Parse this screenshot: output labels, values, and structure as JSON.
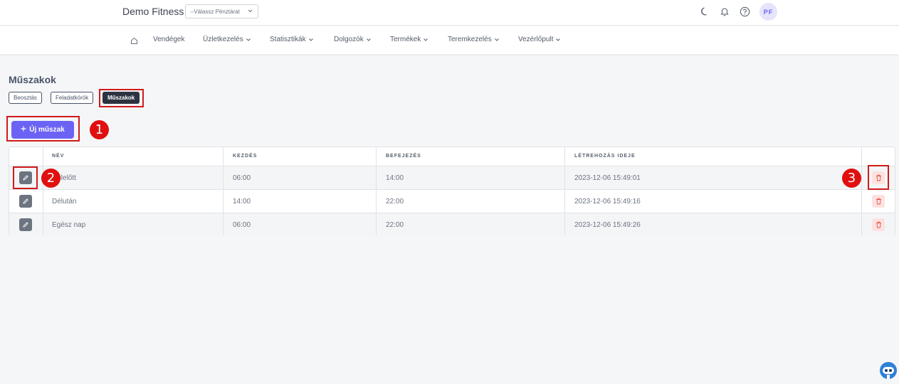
{
  "header": {
    "brand": "Demo Fitness",
    "cashier_select": "--Válassz Pénztárat",
    "avatar": "PF",
    "icons": [
      "moon-icon",
      "bell-icon",
      "help-icon"
    ]
  },
  "nav": {
    "home_icon": "home-icon",
    "items": [
      {
        "label": "Vendégek",
        "dropdown": false
      },
      {
        "label": "Üzletkezelés",
        "dropdown": true
      },
      {
        "label": "Statisztikák",
        "dropdown": true
      },
      {
        "label": "Dolgozók",
        "dropdown": true
      },
      {
        "label": "Termékek",
        "dropdown": true
      },
      {
        "label": "Teremkezelés",
        "dropdown": true
      },
      {
        "label": "Vezérlőpult",
        "dropdown": true
      }
    ]
  },
  "page": {
    "title": "Műszakok",
    "tabs": [
      {
        "label": "Beosztás",
        "active": false
      },
      {
        "label": "Feladatkörök",
        "active": false
      },
      {
        "label": "Műszakok",
        "active": true
      }
    ],
    "new_button": "Új műszak"
  },
  "table": {
    "headers": [
      "NÉV",
      "KEZDÉS",
      "BEFEJEZÉS",
      "LÉTREHOZÁS IDEJE"
    ],
    "rows": [
      {
        "name": "Délelőtt",
        "start": "06:00",
        "end": "14:00",
        "created": "2023-12-06 15:49:01"
      },
      {
        "name": "Délután",
        "start": "14:00",
        "end": "22:00",
        "created": "2023-12-06 15:49:16"
      },
      {
        "name": "Egész nap",
        "start": "06:00",
        "end": "22:00",
        "created": "2023-12-06 15:49:26"
      }
    ]
  },
  "annotations": [
    "1",
    "2",
    "3"
  ],
  "colors": {
    "accent": "#6c63f5",
    "highlight": "#d11a1a",
    "badge": "#e01010",
    "active_tab": "#2d3340",
    "delete_bg": "#fde2e0",
    "delete_icon": "#e5534b"
  }
}
